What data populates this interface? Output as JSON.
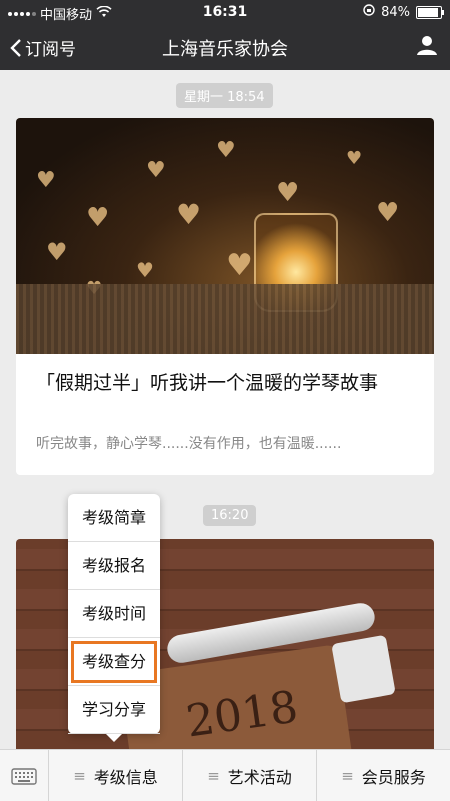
{
  "status": {
    "carrier": "中国移动",
    "time": "16:31",
    "battery": "84%",
    "battery_level": 0.84
  },
  "nav": {
    "back_label": "订阅号",
    "title": "上海音乐家协会"
  },
  "messages": [
    {
      "time": "星期一 18:54",
      "title": "「假期过半」听我讲一个温暖的学琴故事",
      "desc": "听完故事，静心学琴......没有作用，也有温暖......"
    },
    {
      "time": "16:20",
      "cover_text": "2018"
    }
  ],
  "popup_menu": {
    "items": [
      "考级简章",
      "考级报名",
      "考级时间",
      "考级查分",
      "学习分享"
    ],
    "highlighted": "考级查分",
    "highlight_color": "#e87722"
  },
  "tabbar": {
    "tabs": [
      "考级信息",
      "艺术活动",
      "会员服务"
    ]
  }
}
